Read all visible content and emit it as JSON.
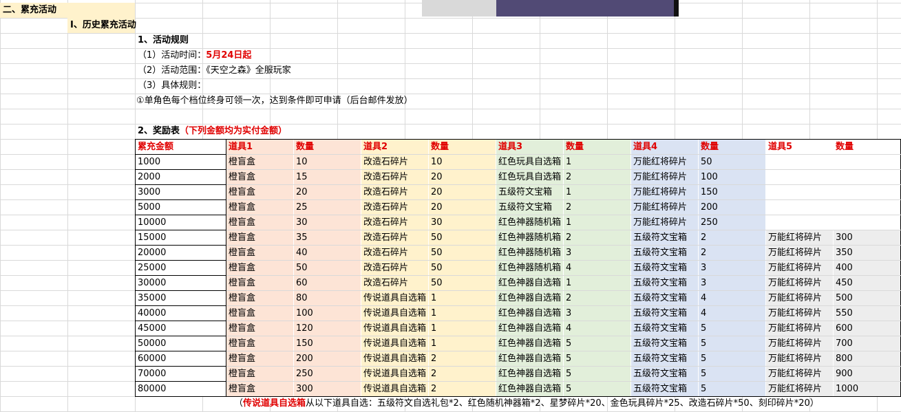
{
  "section_title": "二、累充活动",
  "sub_title": "I、历史累充活动",
  "rules": {
    "heading": "1、活动规则",
    "time_label": "（1）活动时间：",
    "time_value": "5月24日起",
    "scope": "（2）活动范围：《天空之森》全服玩家",
    "detail_label": "（3）具体规则：",
    "detail_item": "①单角色每个档位终身可领一次，达到条件即可申请（后台邮件发放）"
  },
  "rewards": {
    "heading": "2、奖励表",
    "heading_note": "（下列金额均为实付金额）",
    "headers": [
      "累充金额",
      "道具1",
      "数量",
      "道具2",
      "数量",
      "道具3",
      "数量",
      "道具4",
      "数量",
      "道具5",
      "数量"
    ],
    "rows": [
      [
        "1000",
        "橙盲盒",
        "10",
        "改造石碎片",
        "10",
        "红色玩具自选箱",
        "1",
        "万能红将碎片",
        "50",
        "",
        ""
      ],
      [
        "2000",
        "橙盲盒",
        "15",
        "改造石碎片",
        "20",
        "红色玩具自选箱",
        "2",
        "万能红将碎片",
        "100",
        "",
        ""
      ],
      [
        "3000",
        "橙盲盒",
        "20",
        "改造石碎片",
        "20",
        "五级符文宝箱",
        "1",
        "万能红将碎片",
        "150",
        "",
        ""
      ],
      [
        "5000",
        "橙盲盒",
        "25",
        "改造石碎片",
        "20",
        "五级符文宝箱",
        "2",
        "万能红将碎片",
        "200",
        "",
        ""
      ],
      [
        "10000",
        "橙盲盒",
        "30",
        "改造石碎片",
        "30",
        "红色神器随机箱",
        "1",
        "万能红将碎片",
        "250",
        "",
        ""
      ],
      [
        "15000",
        "橙盲盒",
        "35",
        "改造石碎片",
        "50",
        "红色神器随机箱",
        "2",
        "五级符文宝箱",
        "2",
        "万能红将碎片",
        "300"
      ],
      [
        "20000",
        "橙盲盒",
        "40",
        "改造石碎片",
        "50",
        "红色神器随机箱",
        "3",
        "五级符文宝箱",
        "2",
        "万能红将碎片",
        "350"
      ],
      [
        "25000",
        "橙盲盒",
        "50",
        "改造石碎片",
        "50",
        "红色神器随机箱",
        "4",
        "五级符文宝箱",
        "3",
        "万能红将碎片",
        "400"
      ],
      [
        "30000",
        "橙盲盒",
        "60",
        "改造石碎片",
        "50",
        "红色神器自选箱",
        "1",
        "五级符文宝箱",
        "3",
        "万能红将碎片",
        "450"
      ],
      [
        "35000",
        "橙盲盒",
        "80",
        "传说道具自选箱",
        "1",
        "红色神器自选箱",
        "2",
        "五级符文宝箱",
        "4",
        "万能红将碎片",
        "500"
      ],
      [
        "40000",
        "橙盲盒",
        "100",
        "传说道具自选箱",
        "1",
        "红色神器自选箱",
        "3",
        "五级符文宝箱",
        "4",
        "万能红将碎片",
        "550"
      ],
      [
        "45000",
        "橙盲盒",
        "120",
        "传说道具自选箱",
        "1",
        "红色神器自选箱",
        "4",
        "五级符文宝箱",
        "5",
        "万能红将碎片",
        "600"
      ],
      [
        "50000",
        "橙盲盒",
        "150",
        "传说道具自选箱",
        "1",
        "红色神器自选箱",
        "5",
        "五级符文宝箱",
        "5",
        "万能红将碎片",
        "700"
      ],
      [
        "60000",
        "橙盲盒",
        "200",
        "传说道具自选箱",
        "2",
        "红色神器自选箱",
        "5",
        "五级符文宝箱",
        "5",
        "万能红将碎片",
        "800"
      ],
      [
        "70000",
        "橙盲盒",
        "250",
        "传说道具自选箱",
        "2",
        "红色神器自选箱",
        "5",
        "五级符文宝箱",
        "5",
        "万能红将碎片",
        "900"
      ],
      [
        "80000",
        "橙盲盒",
        "300",
        "传说道具自选箱",
        "2",
        "红色神器自选箱",
        "5",
        "五级符文宝箱",
        "5",
        "万能红将碎片",
        "1000"
      ]
    ],
    "note_prefix": "（",
    "note_highlight": "传说道具自选箱",
    "note_rest": "从以下道具自选：五级符文自选礼包*2、红色随机神器箱*2、星梦碎片*20、金色玩具碎片*25、改造石碎片*50、刻印碎片*20）"
  },
  "colors": {
    "item1_bg": "#fde4d6",
    "item2_bg": "#fff2cc",
    "item3_bg": "#e2efda",
    "item4_bg": "#dae3f3",
    "item5_bg": "#ededed",
    "accent_red": "#e00000"
  }
}
